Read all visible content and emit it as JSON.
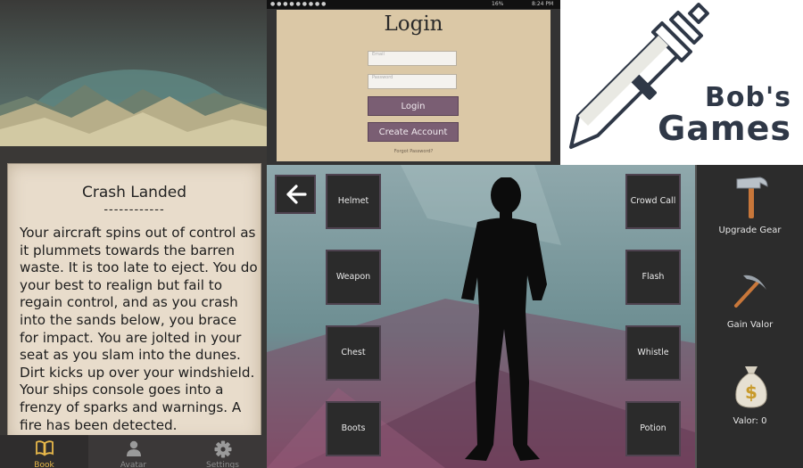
{
  "book": {
    "title": "Crash Landed",
    "divider": "------------",
    "body": "Your aircraft spins out of control as it plummets towards the barren waste. It is too late to eject. You do your best to realign but fail to regain control, and as you crash into the sands below, you brace for impact. You are jolted in your seat as you slam into the dunes. Dirt kicks up over your windshield. Your ships console goes into a frenzy of sparks and warnings. A fire has been detected."
  },
  "bottom_nav": {
    "items": [
      {
        "label": "Book",
        "icon": "book-icon",
        "active": true
      },
      {
        "label": "Avatar",
        "icon": "person-icon",
        "active": false
      },
      {
        "label": "Settings",
        "icon": "gear-icon",
        "active": false
      }
    ],
    "active_color": "#e8b84a"
  },
  "login": {
    "status_bar": {
      "time": "8:24 PM",
      "battery": "16%"
    },
    "title": "Login",
    "email_placeholder": "Email",
    "password_placeholder": "Password",
    "login_label": "Login",
    "create_account_label": "Create Account",
    "forgot_label": "Forgot Password?"
  },
  "logo": {
    "text_line1": "Bob's",
    "text_line2": "Games",
    "color": "#2f3847"
  },
  "equipment": {
    "back_icon": "arrow-left-icon",
    "left_slots": [
      "Helmet",
      "Weapon",
      "Chest",
      "Boots"
    ],
    "right_slots": [
      "Crowd Call",
      "Flash",
      "Whistle",
      "Potion"
    ]
  },
  "sidebar": {
    "upgrade_label": "Upgrade Gear",
    "upgrade_icon": "hammer-icon",
    "valor_label": "Gain Valor",
    "valor_icon": "pickaxe-icon",
    "valor_count_label": "Valor: 0",
    "valor_count_icon": "money-bag-icon"
  }
}
